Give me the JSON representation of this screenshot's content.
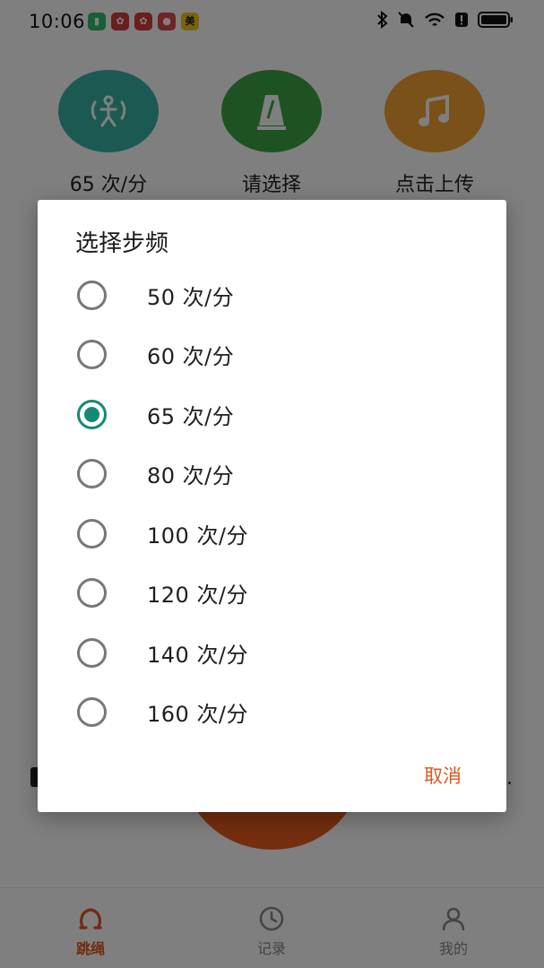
{
  "status_bar": {
    "time": "10:06",
    "app_icons": [
      {
        "name": "battery-app-icon",
        "color": "#2fbf71"
      },
      {
        "name": "huawei-icon",
        "color": "#d83b3b"
      },
      {
        "name": "huawei-icon",
        "color": "#d83b3b"
      },
      {
        "name": "game-app-icon",
        "color": "#e04848"
      },
      {
        "name": "meituan-icon",
        "color": "#f6c619",
        "glyph": "美"
      }
    ],
    "right_icons": [
      "bluetooth-icon",
      "mute-icon",
      "wifi-icon",
      "alert-icon",
      "battery-icon"
    ]
  },
  "features": [
    {
      "label": "65 次/分",
      "icon": "jump-person-icon",
      "color": "#3bb3a6"
    },
    {
      "label": "请选择",
      "icon": "metronome-icon",
      "color": "#3fa544"
    },
    {
      "label": "点击上传",
      "icon": "music-note-icon",
      "color": "#f3a233"
    }
  ],
  "dialog": {
    "title": "选择步频",
    "selected_index": 2,
    "accent": "#138a73",
    "options": [
      {
        "label": "50 次/分"
      },
      {
        "label": "60 次/分"
      },
      {
        "label": "65 次/分"
      },
      {
        "label": "80 次/分"
      },
      {
        "label": "100 次/分"
      },
      {
        "label": "120 次/分"
      },
      {
        "label": "140 次/分"
      },
      {
        "label": "160 次/分"
      }
    ],
    "cancel_label": "取消"
  },
  "bottom_nav": {
    "active_color": "#e5571d",
    "items": [
      {
        "label": "跳绳",
        "icon": "jump-rope-icon",
        "active": true
      },
      {
        "label": "记录",
        "icon": "clock-icon",
        "active": false
      },
      {
        "label": "我的",
        "icon": "person-icon",
        "active": false
      }
    ]
  }
}
